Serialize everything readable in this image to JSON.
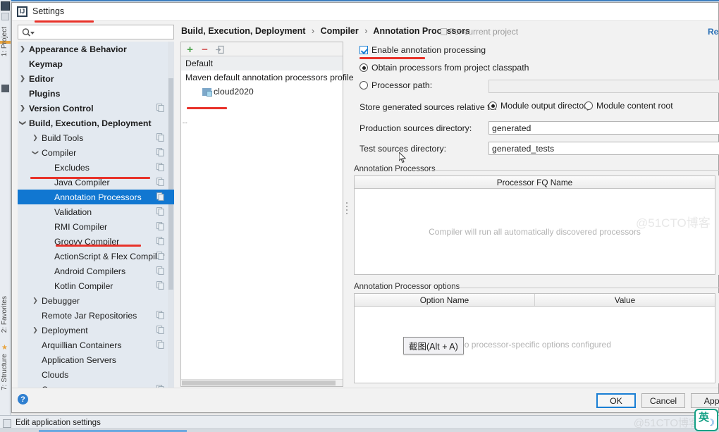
{
  "window": {
    "title": "Settings",
    "icon": "intellij-idea-icon"
  },
  "ide": {
    "tool_strips": [
      {
        "label": "1: Project"
      },
      {
        "label": "2: Favorites"
      },
      {
        "label": "7: Structure"
      }
    ],
    "status_bar_text": "Edit application settings",
    "watermark_bottom": "@51CTO博客",
    "watermark_middle": "@51CTO博客",
    "ime_indicator": {
      "label": "英",
      "icon": "moon-icon"
    }
  },
  "search": {
    "placeholder": "",
    "value": "",
    "icon": "search-icon"
  },
  "sidebar": {
    "items": [
      {
        "label": "Appearance & Behavior",
        "arrow": "collapsed",
        "indent": 0,
        "bold": true,
        "badge": false,
        "selected": false
      },
      {
        "label": "Keymap",
        "arrow": "none",
        "indent": 0,
        "bold": true,
        "badge": false,
        "selected": false
      },
      {
        "label": "Editor",
        "arrow": "collapsed",
        "indent": 0,
        "bold": true,
        "badge": false,
        "selected": false
      },
      {
        "label": "Plugins",
        "arrow": "none",
        "indent": 0,
        "bold": true,
        "badge": false,
        "selected": false
      },
      {
        "label": "Version Control",
        "arrow": "collapsed",
        "indent": 0,
        "bold": true,
        "badge": true,
        "selected": false
      },
      {
        "label": "Build, Execution, Deployment",
        "arrow": "expanded",
        "indent": 0,
        "bold": true,
        "badge": false,
        "selected": false
      },
      {
        "label": "Build Tools",
        "arrow": "collapsed",
        "indent": 1,
        "bold": false,
        "badge": true,
        "selected": false
      },
      {
        "label": "Compiler",
        "arrow": "expanded",
        "indent": 1,
        "bold": false,
        "badge": true,
        "selected": false
      },
      {
        "label": "Excludes",
        "arrow": "none",
        "indent": 2,
        "bold": false,
        "badge": true,
        "selected": false
      },
      {
        "label": "Java Compiler",
        "arrow": "none",
        "indent": 2,
        "bold": false,
        "badge": true,
        "selected": false
      },
      {
        "label": "Annotation Processors",
        "arrow": "none",
        "indent": 2,
        "bold": false,
        "badge": true,
        "selected": true
      },
      {
        "label": "Validation",
        "arrow": "none",
        "indent": 2,
        "bold": false,
        "badge": true,
        "selected": false
      },
      {
        "label": "RMI Compiler",
        "arrow": "none",
        "indent": 2,
        "bold": false,
        "badge": true,
        "selected": false
      },
      {
        "label": "Groovy Compiler",
        "arrow": "none",
        "indent": 2,
        "bold": false,
        "badge": true,
        "selected": false
      },
      {
        "label": "ActionScript & Flex Compiler",
        "arrow": "none",
        "indent": 2,
        "bold": false,
        "badge": true,
        "selected": false
      },
      {
        "label": "Android Compilers",
        "arrow": "none",
        "indent": 2,
        "bold": false,
        "badge": true,
        "selected": false
      },
      {
        "label": "Kotlin Compiler",
        "arrow": "none",
        "indent": 2,
        "bold": false,
        "badge": true,
        "selected": false
      },
      {
        "label": "Debugger",
        "arrow": "collapsed",
        "indent": 1,
        "bold": false,
        "badge": false,
        "selected": false
      },
      {
        "label": "Remote Jar Repositories",
        "arrow": "none",
        "indent": 1,
        "bold": false,
        "badge": true,
        "selected": false
      },
      {
        "label": "Deployment",
        "arrow": "collapsed",
        "indent": 1,
        "bold": false,
        "badge": true,
        "selected": false
      },
      {
        "label": "Arquillian Containers",
        "arrow": "none",
        "indent": 1,
        "bold": false,
        "badge": true,
        "selected": false
      },
      {
        "label": "Application Servers",
        "arrow": "none",
        "indent": 1,
        "bold": false,
        "badge": false,
        "selected": false
      },
      {
        "label": "Clouds",
        "arrow": "none",
        "indent": 1,
        "bold": false,
        "badge": false,
        "selected": false
      },
      {
        "label": "Coverage",
        "arrow": "none",
        "indent": 1,
        "bold": false,
        "badge": true,
        "selected": false
      }
    ]
  },
  "breadcrumb": {
    "parts": [
      "Build, Execution, Deployment",
      "Compiler",
      "Annotation Processors"
    ],
    "separator": "›",
    "scope_label": "For current project",
    "scope_icon": "project-scope-icon",
    "reset_label": "Res"
  },
  "profiles": {
    "toolbar": {
      "add_label": "+",
      "remove_label": "−",
      "move_icon": "move-to-profile-icon"
    },
    "items": [
      {
        "label": "Default",
        "type": "profile",
        "selected": true
      },
      {
        "label": "Maven default annotation processors profile",
        "type": "profile",
        "selected": false
      },
      {
        "label": "cloud2020",
        "type": "module",
        "icon": "module-icon"
      }
    ]
  },
  "main": {
    "enable_annotation_processing": {
      "label": "Enable annotation processing",
      "checked": true
    },
    "processor_source": {
      "options": [
        {
          "label": "Obtain processors from project classpath",
          "selected": true
        },
        {
          "label": "Processor path:",
          "selected": false
        }
      ],
      "processor_path_value": "",
      "browse_label": "…"
    },
    "store_relative": {
      "label": "Store generated sources relative to:",
      "options": [
        {
          "label": "Module output directory",
          "selected": true
        },
        {
          "label": "Module content root",
          "selected": false
        }
      ]
    },
    "production_sources": {
      "label": "Production sources directory:",
      "value": "generated"
    },
    "test_sources": {
      "label": "Test sources directory:",
      "value": "generated_tests"
    },
    "processors_table": {
      "group_label": "Annotation Processors",
      "columns": [
        "Processor FQ Name"
      ],
      "rows": [],
      "empty_text": "Compiler will run all automatically discovered processors",
      "add_label": "+",
      "remove_label": "−"
    },
    "options_table": {
      "group_label": "Annotation Processor options",
      "columns": [
        "Option Name",
        "Value"
      ],
      "rows": [],
      "empty_text": "No processor-specific options configured",
      "add_label": "+",
      "remove_label": "−"
    },
    "tooltip": {
      "text": "截图(Alt + A)"
    }
  },
  "footer": {
    "help_label": "?",
    "ok_label": "OK",
    "cancel_label": "Cancel",
    "apply_label": "Appl"
  },
  "colors": {
    "selection_blue": "#1177d1",
    "annotation_red": "#e8322a",
    "link_blue": "#2a6fb5",
    "accent_green": "#4aa24a"
  }
}
